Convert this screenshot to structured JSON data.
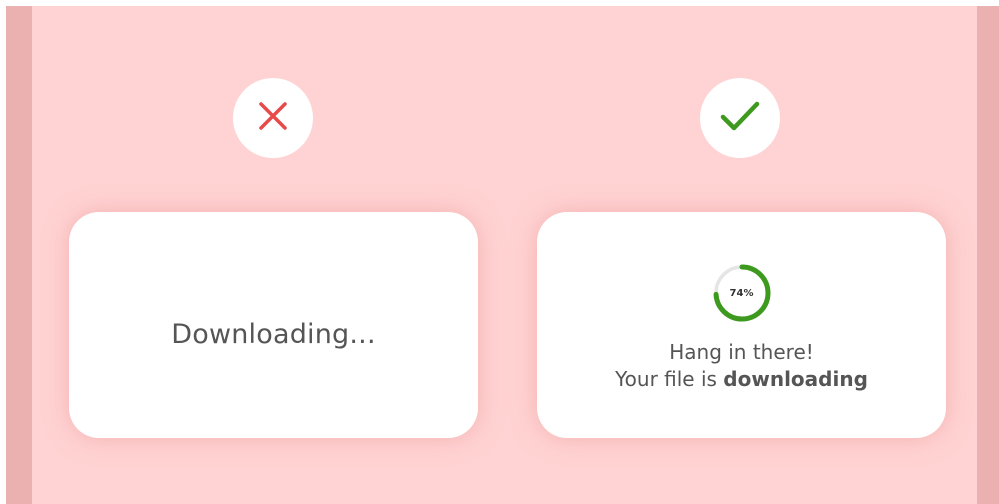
{
  "colors": {
    "background": "#ffd3d3",
    "edge": "#ebb1b1",
    "card": "#ffffff",
    "bad": "#e84a4a",
    "good": "#3d9a1f",
    "track": "#e5e5e5",
    "text": "#555555"
  },
  "icons": {
    "bad": "close-icon",
    "good": "checkmark-icon"
  },
  "bad_example": {
    "text": "Downloading..."
  },
  "good_example": {
    "progress_percent": 74,
    "progress_label": "74%",
    "line1": "Hang in there!",
    "line2_prefix": "Your file is ",
    "line2_bold": "downloading"
  }
}
